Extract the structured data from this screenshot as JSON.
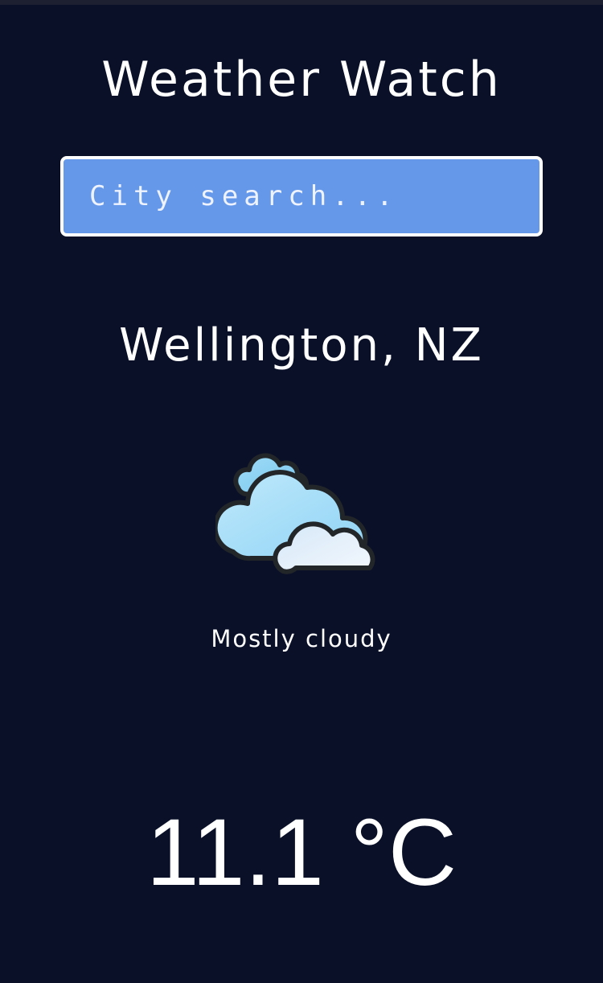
{
  "app": {
    "title": "Weather Watch"
  },
  "search": {
    "placeholder": "City search...",
    "value": ""
  },
  "weather": {
    "location": "Wellington, NZ",
    "icon": "cloudy-icon",
    "condition": "Mostly cloudy",
    "temperature": "11.1 °C"
  },
  "colors": {
    "background": "#0a1028",
    "search_fill": "#6698ea",
    "search_border": "#ffffff",
    "text": "#ffffff"
  }
}
